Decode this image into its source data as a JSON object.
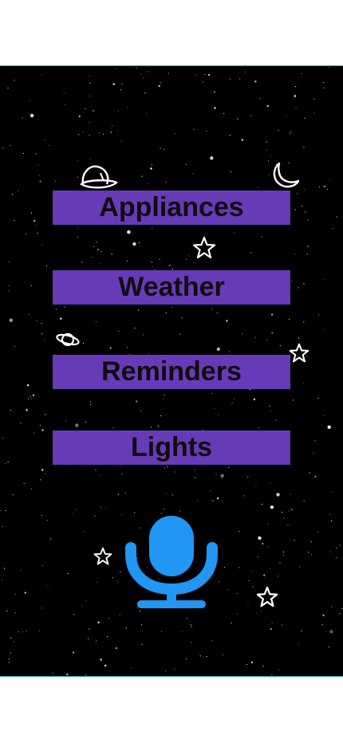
{
  "menu": {
    "items": [
      {
        "id": "appliances",
        "label": "Appliances"
      },
      {
        "id": "weather",
        "label": "Weather"
      },
      {
        "id": "reminders",
        "label": "Reminders"
      },
      {
        "id": "lights",
        "label": "Lights"
      }
    ]
  },
  "mic": {
    "icon": "microphone-icon",
    "color": "#2196f3"
  },
  "theme": {
    "background": "#000000",
    "button_color": "#673ab7",
    "button_text_color": "#0d0d0d",
    "border_color": "#2aa7b8"
  }
}
